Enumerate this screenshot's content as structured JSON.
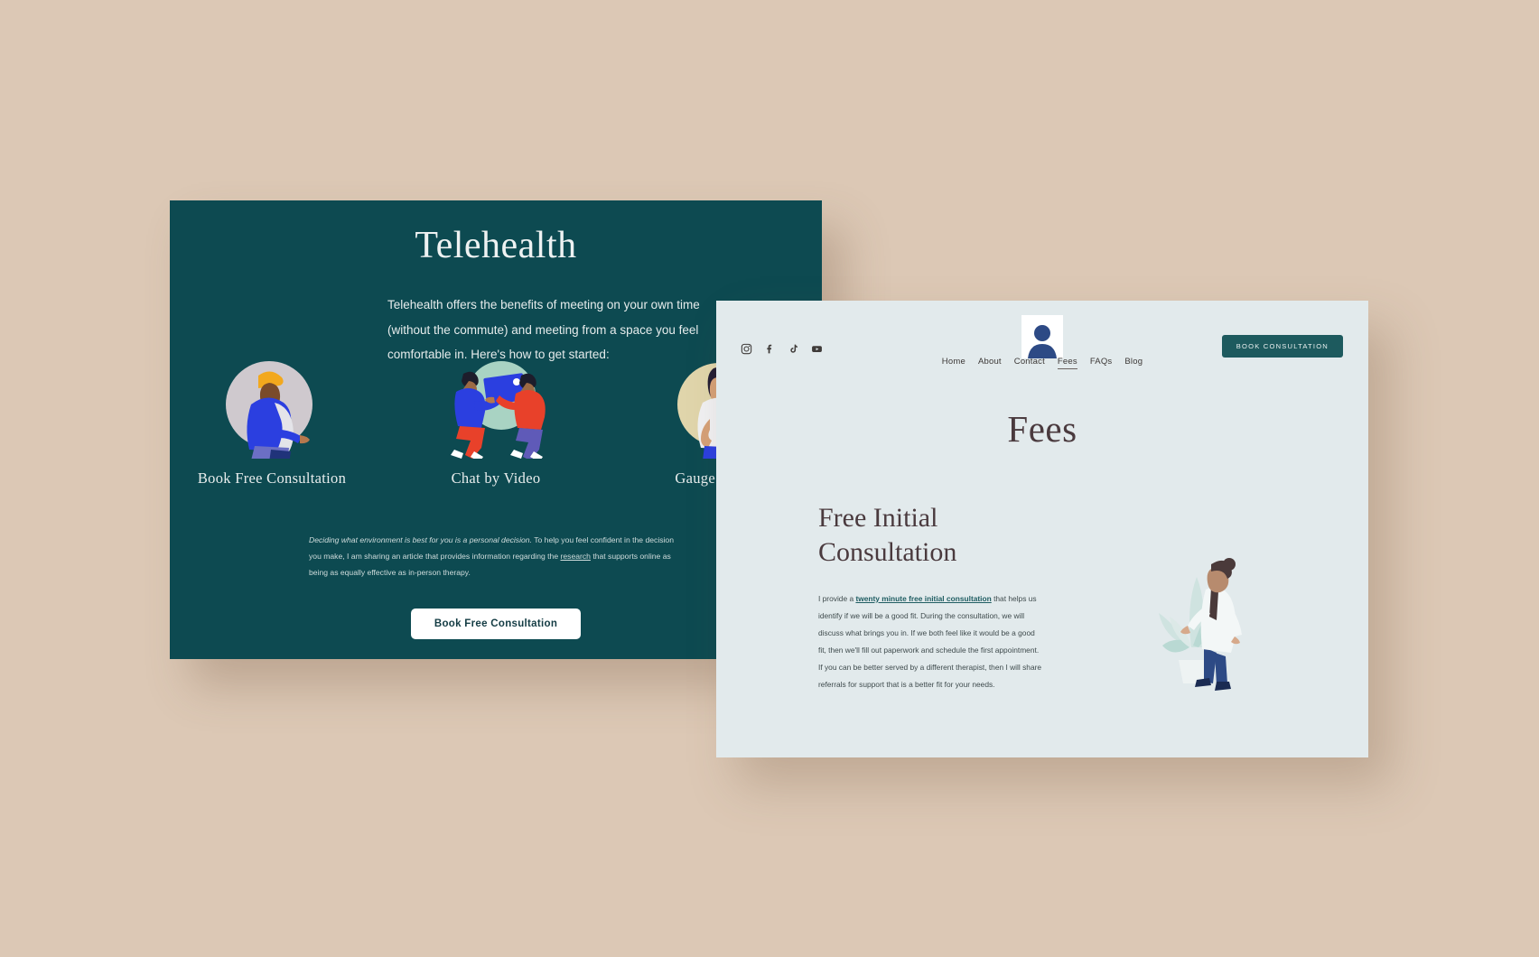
{
  "canvas": {
    "background_color": "#dcc8b5"
  },
  "telehealth_panel": {
    "background_color": "#0d4a51",
    "title": "Telehealth",
    "intro": "Telehealth offers the benefits of meeting on your own time (without the commute) and meeting from a space you feel comfortable in. Here's how to get started:",
    "steps": [
      {
        "label": "Book Free Consultation",
        "art": "person-pointing-illustration"
      },
      {
        "label": "Chat by Video",
        "art": "two-people-video-illustration"
      },
      {
        "label": "Gauge Our Fit",
        "art": "person-standing-illustration"
      }
    ],
    "note": {
      "italic_part": "Deciding what environment is best for you is a personal decision.",
      "rest_before_link": " To help you feel confident in the decision you make, I am sharing an article that provides information regarding the ",
      "link_text": "research",
      "rest_after_link": " that supports online as being as equally effective as in-person therapy."
    },
    "cta_label": "Book Free Consultation"
  },
  "fees_panel": {
    "background_color": "#e2eaec",
    "social_icons": [
      "instagram-icon",
      "facebook-icon",
      "tiktok-icon",
      "youtube-icon"
    ],
    "logo_alt": "therapist-avatar-logo",
    "nav": [
      {
        "label": "Home",
        "active": false
      },
      {
        "label": "About",
        "active": false
      },
      {
        "label": "Contact",
        "active": false
      },
      {
        "label": "Fees",
        "active": true
      },
      {
        "label": "FAQs",
        "active": false
      },
      {
        "label": "Blog",
        "active": false
      }
    ],
    "book_button_label": "BOOK CONSULTATION",
    "book_button_color": "#1d5a5e",
    "page_title": "Fees",
    "section_heading": "Free Initial Consultation",
    "paragraph": {
      "before_link": "I provide a ",
      "link_text": "twenty minute free initial consultation",
      "after_link": " that helps us identify if we will be a good fit.  During the consultation, we will discuss what brings you in. If we both feel like it would be a good fit, then we'll fill out paperwork and schedule the first appointment. If you can be better served by a different therapist, then I will share referrals for support that is a better fit for your needs."
    },
    "illustration_alt": "woman-with-plant-illustration"
  }
}
